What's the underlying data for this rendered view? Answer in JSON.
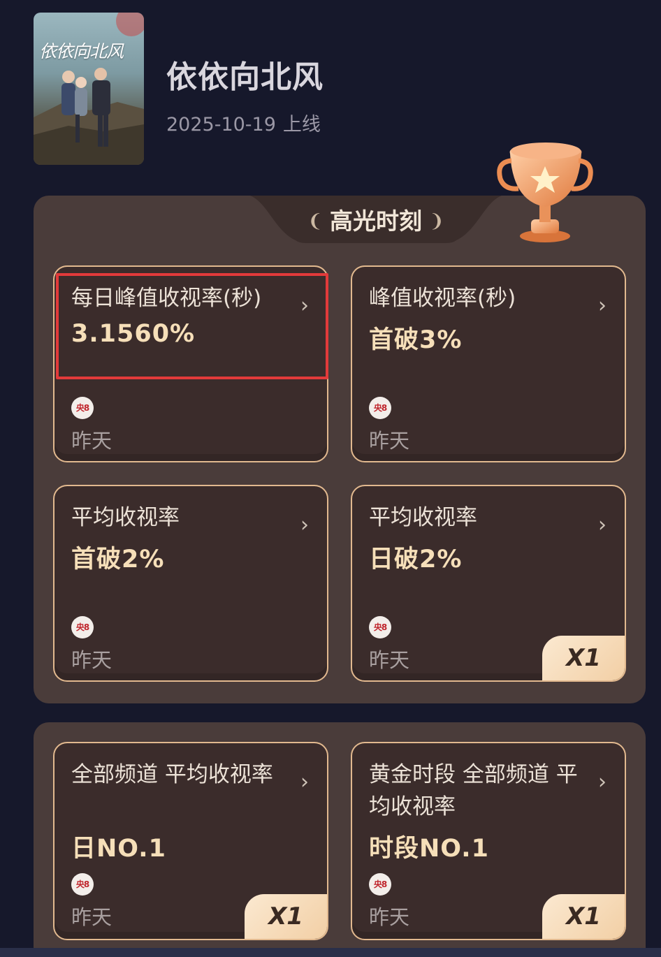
{
  "show": {
    "poster_title": "依依向北风",
    "title": "依依向北风",
    "release_date": "2025-10-19",
    "release_label": "上线"
  },
  "highlights": {
    "section_title": "高光时刻",
    "laurel_left": "❨",
    "laurel_right": "❩"
  },
  "cards": [
    {
      "title": "每日峰值收视率(秒)",
      "value": "3.1560%",
      "channel": "央8",
      "time": "昨天",
      "badge": ""
    },
    {
      "title": "峰值收视率(秒)",
      "value": "首破3%",
      "channel": "央8",
      "time": "昨天",
      "badge": ""
    },
    {
      "title": "平均收视率",
      "value": "首破2%",
      "channel": "央8",
      "time": "昨天",
      "badge": ""
    },
    {
      "title": "平均收视率",
      "value": "日破2%",
      "channel": "央8",
      "time": "昨天",
      "badge": "X1"
    },
    {
      "title": "全部频道 平均收视率",
      "value": "日NO.1",
      "channel": "央8",
      "time": "昨天",
      "badge": "X1"
    },
    {
      "title": "黄金时段 全部频道 平均收视率",
      "value": "时段NO.1",
      "channel": "央8",
      "time": "昨天",
      "badge": "X1"
    }
  ],
  "icons": {
    "chevron": "›",
    "trophy": "trophy-icon",
    "channel_logo": "cctv8-logo-icon"
  },
  "colors": {
    "background": "#16182b",
    "panel": "#4a3c3a",
    "card": "#3b2c2b",
    "card_border": "#e2b98f",
    "value_text": "#f6dfb9",
    "highlight_box": "#e23a3a"
  }
}
